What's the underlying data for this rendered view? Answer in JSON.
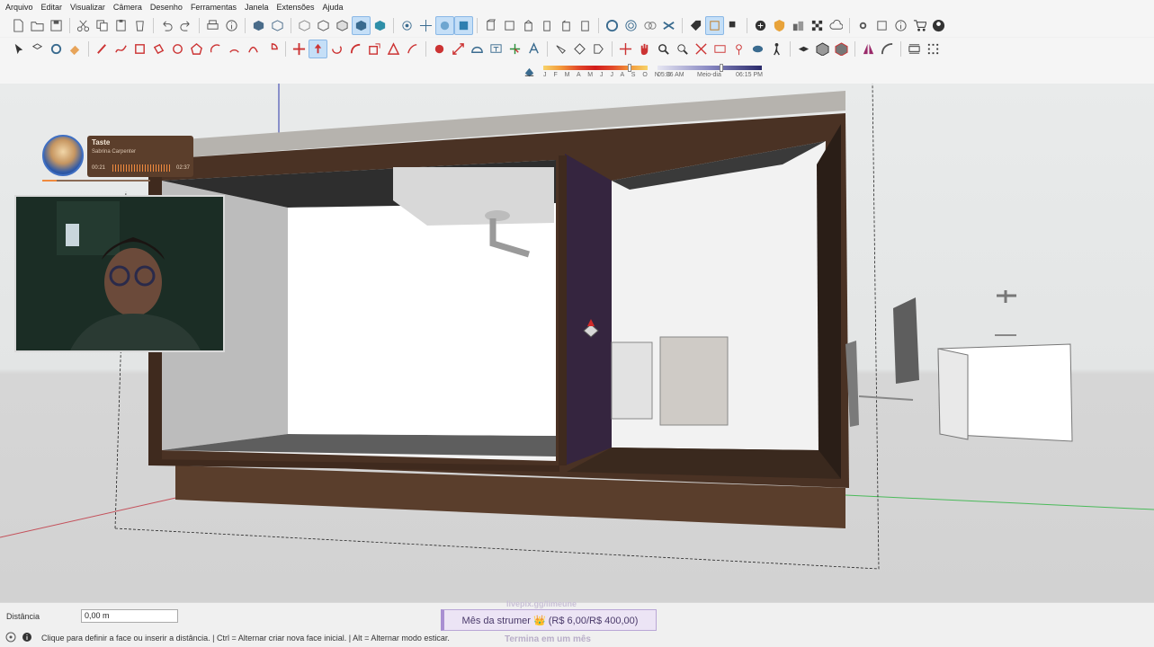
{
  "menu": [
    "Arquivo",
    "Editar",
    "Visualizar",
    "Câmera",
    "Desenho",
    "Ferramentas",
    "Janela",
    "Extensões",
    "Ajuda"
  ],
  "shadow_bar": {
    "months": "J F M A M J J A S O N D",
    "time_start": "05:36 AM",
    "time_mid": "Meio-dia",
    "time_end": "06:15 PM"
  },
  "music_widget": {
    "title": "Taste",
    "artist": "Sabrina Carpenter",
    "time_elapsed": "00:21",
    "time_total": "02:37",
    "progress": 0.13
  },
  "status": {
    "measure_label": "Distância",
    "measure_value": "0,00 m",
    "hint": "Clique para definir a face ou inserir a distância. | Ctrl = Alternar criar nova face inicial. | Alt = Alternar modo esticar."
  },
  "subathon": {
    "top_text": "livepix.gg/limeune",
    "goal": "Mês da strumer 👑 (R$ 6,00/R$ 400,00)",
    "sub_text": "Termina em um mês"
  },
  "colors": {
    "wood_dark": "#3f2a1e",
    "wood_mid": "#5a3e2c",
    "countertop": "#b6b3ae",
    "active_tool": "#c5dff7"
  }
}
